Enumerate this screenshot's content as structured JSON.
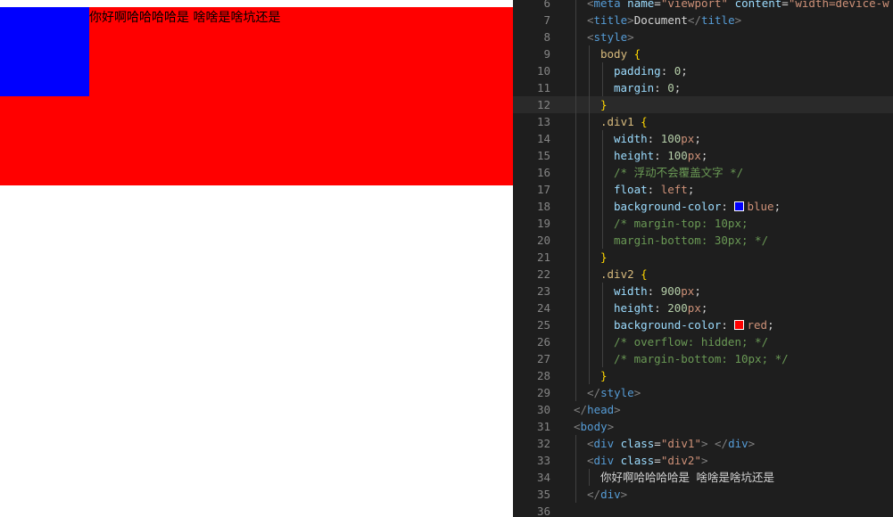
{
  "preview": {
    "text": "你好啊哈哈哈哈是 啥啥是啥坑还是",
    "red_color": "#ff0000",
    "blue_color": "#0000ff"
  },
  "editor": {
    "active_line": 12,
    "lines": [
      {
        "n": 6,
        "indent": 1,
        "tokens": [
          [
            "t-punct",
            "<"
          ],
          [
            "t-tag",
            "meta"
          ],
          [
            "t-plain",
            " "
          ],
          [
            "t-attr",
            "name"
          ],
          [
            "t-plain",
            "="
          ],
          [
            "t-str",
            "\"viewport\""
          ],
          [
            "t-plain",
            " "
          ],
          [
            "t-attr",
            "content"
          ],
          [
            "t-plain",
            "="
          ],
          [
            "t-str",
            "\"width=device-w"
          ]
        ]
      },
      {
        "n": 7,
        "indent": 1,
        "tokens": [
          [
            "t-punct",
            "<"
          ],
          [
            "t-tag",
            "title"
          ],
          [
            "t-punct",
            ">"
          ],
          [
            "t-text",
            "Document"
          ],
          [
            "t-punct",
            "</"
          ],
          [
            "t-tag",
            "title"
          ],
          [
            "t-punct",
            ">"
          ]
        ]
      },
      {
        "n": 8,
        "indent": 1,
        "tokens": [
          [
            "t-punct",
            "<"
          ],
          [
            "t-tag",
            "style"
          ],
          [
            "t-punct",
            ">"
          ]
        ]
      },
      {
        "n": 9,
        "indent": 2,
        "tokens": [
          [
            "t-sel",
            "body"
          ],
          [
            "t-plain",
            " "
          ],
          [
            "t-brace",
            "{"
          ]
        ]
      },
      {
        "n": 10,
        "indent": 3,
        "tokens": [
          [
            "t-prop",
            "padding"
          ],
          [
            "t-plain",
            ": "
          ],
          [
            "t-num",
            "0"
          ],
          [
            "t-plain",
            ";"
          ]
        ]
      },
      {
        "n": 11,
        "indent": 3,
        "tokens": [
          [
            "t-prop",
            "margin"
          ],
          [
            "t-plain",
            ": "
          ],
          [
            "t-num",
            "0"
          ],
          [
            "t-plain",
            ";"
          ]
        ]
      },
      {
        "n": 12,
        "indent": 2,
        "tokens": [
          [
            "t-brace",
            "}"
          ]
        ]
      },
      {
        "n": 13,
        "indent": 2,
        "tokens": [
          [
            "t-sel",
            ".div1"
          ],
          [
            "t-plain",
            " "
          ],
          [
            "t-brace",
            "{"
          ]
        ]
      },
      {
        "n": 14,
        "indent": 3,
        "tokens": [
          [
            "t-prop",
            "width"
          ],
          [
            "t-plain",
            ": "
          ],
          [
            "t-num",
            "100"
          ],
          [
            "t-kw",
            "px"
          ],
          [
            "t-plain",
            ";"
          ]
        ]
      },
      {
        "n": 15,
        "indent": 3,
        "tokens": [
          [
            "t-prop",
            "height"
          ],
          [
            "t-plain",
            ": "
          ],
          [
            "t-num",
            "100"
          ],
          [
            "t-kw",
            "px"
          ],
          [
            "t-plain",
            ";"
          ]
        ]
      },
      {
        "n": 16,
        "indent": 3,
        "tokens": [
          [
            "t-com",
            "/* 浮动不会覆盖文字 */"
          ]
        ]
      },
      {
        "n": 17,
        "indent": 3,
        "tokens": [
          [
            "t-prop",
            "float"
          ],
          [
            "t-plain",
            ": "
          ],
          [
            "t-kw",
            "left"
          ],
          [
            "t-plain",
            ";"
          ]
        ]
      },
      {
        "n": 18,
        "indent": 3,
        "tokens": [
          [
            "t-prop",
            "background-color"
          ],
          [
            "t-plain",
            ": "
          ],
          [
            "swatch",
            "#0000ff"
          ],
          [
            "t-kw",
            "blue"
          ],
          [
            "t-plain",
            ";"
          ]
        ]
      },
      {
        "n": 19,
        "indent": 3,
        "tokens": [
          [
            "t-com",
            "/* margin-top: 10px;"
          ]
        ]
      },
      {
        "n": 20,
        "indent": 3,
        "tokens": [
          [
            "t-com",
            "margin-bottom: 30px; */"
          ]
        ]
      },
      {
        "n": 21,
        "indent": 2,
        "tokens": [
          [
            "t-brace",
            "}"
          ]
        ]
      },
      {
        "n": 22,
        "indent": 2,
        "tokens": [
          [
            "t-sel",
            ".div2"
          ],
          [
            "t-plain",
            " "
          ],
          [
            "t-brace",
            "{"
          ]
        ]
      },
      {
        "n": 23,
        "indent": 3,
        "tokens": [
          [
            "t-prop",
            "width"
          ],
          [
            "t-plain",
            ": "
          ],
          [
            "t-num",
            "900"
          ],
          [
            "t-kw",
            "px"
          ],
          [
            "t-plain",
            ";"
          ]
        ]
      },
      {
        "n": 24,
        "indent": 3,
        "tokens": [
          [
            "t-prop",
            "height"
          ],
          [
            "t-plain",
            ": "
          ],
          [
            "t-num",
            "200"
          ],
          [
            "t-kw",
            "px"
          ],
          [
            "t-plain",
            ";"
          ]
        ]
      },
      {
        "n": 25,
        "indent": 3,
        "tokens": [
          [
            "t-prop",
            "background-color"
          ],
          [
            "t-plain",
            ": "
          ],
          [
            "swatch",
            "#ff0000"
          ],
          [
            "t-kw",
            "red"
          ],
          [
            "t-plain",
            ";"
          ]
        ]
      },
      {
        "n": 26,
        "indent": 3,
        "tokens": [
          [
            "t-com",
            "/* overflow: hidden; */"
          ]
        ]
      },
      {
        "n": 27,
        "indent": 3,
        "tokens": [
          [
            "t-com",
            "/* margin-bottom: 10px; */"
          ]
        ]
      },
      {
        "n": 28,
        "indent": 2,
        "tokens": [
          [
            "t-brace",
            "}"
          ]
        ]
      },
      {
        "n": 29,
        "indent": 1,
        "tokens": [
          [
            "t-punct",
            "</"
          ],
          [
            "t-tag",
            "style"
          ],
          [
            "t-punct",
            ">"
          ]
        ]
      },
      {
        "n": 30,
        "indent": 0,
        "tokens": [
          [
            "t-punct",
            "</"
          ],
          [
            "t-tag",
            "head"
          ],
          [
            "t-punct",
            ">"
          ]
        ]
      },
      {
        "n": 31,
        "indent": 0,
        "tokens": [
          [
            "t-punct",
            "<"
          ],
          [
            "t-tag",
            "body"
          ],
          [
            "t-punct",
            ">"
          ]
        ]
      },
      {
        "n": 32,
        "indent": 1,
        "tokens": [
          [
            "t-punct",
            "<"
          ],
          [
            "t-tag",
            "div"
          ],
          [
            "t-plain",
            " "
          ],
          [
            "t-attr",
            "class"
          ],
          [
            "t-plain",
            "="
          ],
          [
            "t-str",
            "\"div1\""
          ],
          [
            "t-punct",
            ">"
          ],
          [
            "t-plain",
            " "
          ],
          [
            "t-punct",
            "</"
          ],
          [
            "t-tag",
            "div"
          ],
          [
            "t-punct",
            ">"
          ]
        ]
      },
      {
        "n": 33,
        "indent": 1,
        "tokens": [
          [
            "t-punct",
            "<"
          ],
          [
            "t-tag",
            "div"
          ],
          [
            "t-plain",
            " "
          ],
          [
            "t-attr",
            "class"
          ],
          [
            "t-plain",
            "="
          ],
          [
            "t-str",
            "\"div2\""
          ],
          [
            "t-punct",
            ">"
          ]
        ]
      },
      {
        "n": 34,
        "indent": 2,
        "tokens": [
          [
            "t-text",
            "你好啊哈哈哈哈是 啥啥是啥坑还是"
          ]
        ]
      },
      {
        "n": 35,
        "indent": 1,
        "tokens": [
          [
            "t-punct",
            "</"
          ],
          [
            "t-tag",
            "div"
          ],
          [
            "t-punct",
            ">"
          ]
        ]
      },
      {
        "n": 36,
        "indent": 0,
        "tokens": []
      }
    ]
  }
}
